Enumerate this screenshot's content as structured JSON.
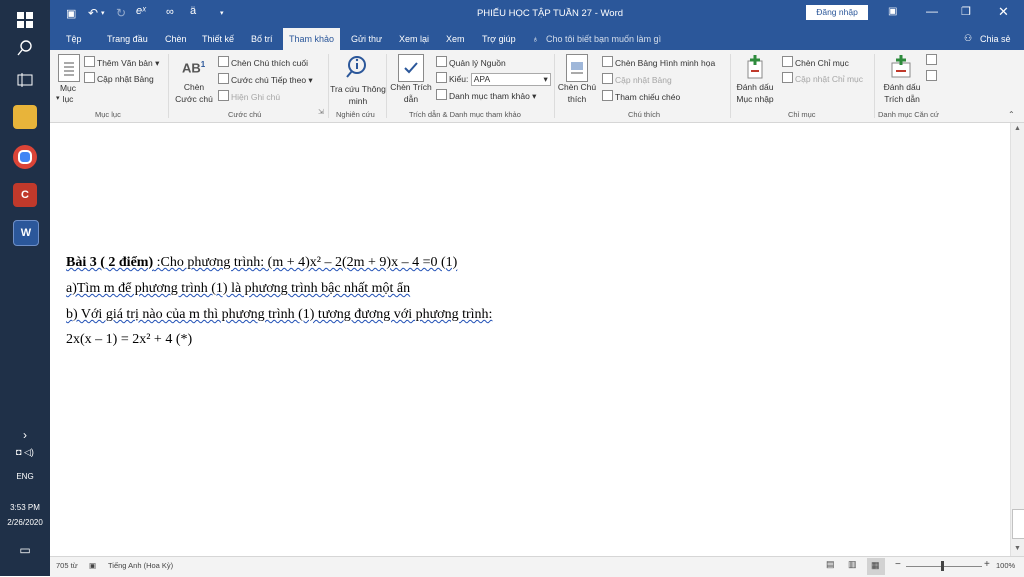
{
  "taskbar": {
    "time": "3:53 PM",
    "date": "2/26/2020",
    "language": "ENG"
  },
  "titlebar": {
    "title": "PHIẾU HỌC TẬP TUẦN 27 - Word",
    "signin": "Đăng nhập"
  },
  "tabs": [
    "Tệp",
    "Trang đầu",
    "Chèn",
    "Thiết kế",
    "Bố trí",
    "Tham khảo",
    "Gửi thư",
    "Xem lại",
    "Xem",
    "Trợ giúp"
  ],
  "tellme": "Cho tôi biết bạn muốn làm gì",
  "share": "Chia sẻ",
  "ribbon": {
    "muc_luc": {
      "button": "Mục lục",
      "them_van_ban": "Thêm Văn bản",
      "cap_nhat_bang": "Cập nhật Bảng",
      "group": "Mục lục"
    },
    "cuoc_chu": {
      "chen_cuoc_chu": "Chèn Cước chú",
      "chen_chu_thich_cuoi": "Chèn Chú thích cuối",
      "cuoc_chu_tiep_theo": "Cước chú Tiếp theo",
      "hien_ghi_chu": "Hiện Ghi chú",
      "group": "Cước chú"
    },
    "nghien_cuu": {
      "tra_cuu": "Tra cứu Thông minh",
      "group": "Nghiên cứu"
    },
    "trich_dan": {
      "chen_trich_dan": "Chèn Trích dẫn",
      "quan_ly_nguon": "Quản lý Nguồn",
      "kieu_label": "Kiểu:",
      "kieu_value": "APA",
      "danh_muc_tham_khao": "Danh mục tham khảo",
      "group": "Trích dẫn & Danh mục tham khảo"
    },
    "chu_thich": {
      "chen_chu_thich": "Chèn Chú thích",
      "chen_bang_hinh": "Chèn Bảng Hình minh họa",
      "cap_nhat_bang": "Cập nhật Bảng",
      "tham_chieu_cheo": "Tham chiếu chéo",
      "group": "Chú thích"
    },
    "chi_muc": {
      "danh_dau_muc_nhap": "Đánh dấu Mục nhập",
      "chen_chi_muc": "Chèn Chỉ mục",
      "cap_nhat_chi_muc": "Cập nhật Chỉ mục",
      "group": "Chỉ mục"
    },
    "can_cu": {
      "danh_dau_trich_dan": "Đánh dấu Trích dẫn",
      "group": "Danh mục Căn cứ"
    }
  },
  "document": {
    "bai3_bold": "Bài 3 ( 2 điểm)",
    "bai3_rest": " :Cho phương trình: (m + 4)x² – 2(2m + 9)x – 4 =0 (1)",
    "line_a": "a)Tìm m để phương trình (1) là phương trình bậc nhất một ẩn",
    "line_b": "b) Với giá trị nào của m thì phương trình (1) tương đương với phương trình:",
    "line_eq": "2x(x – 1) = 2x² + 4 (*)"
  },
  "status": {
    "words": "705 từ",
    "language": "Tiếng Anh (Hoa Kỳ)",
    "zoom": "100%"
  },
  "colors": {
    "word_blue": "#2b579a",
    "taskbar": "#1f3048"
  }
}
